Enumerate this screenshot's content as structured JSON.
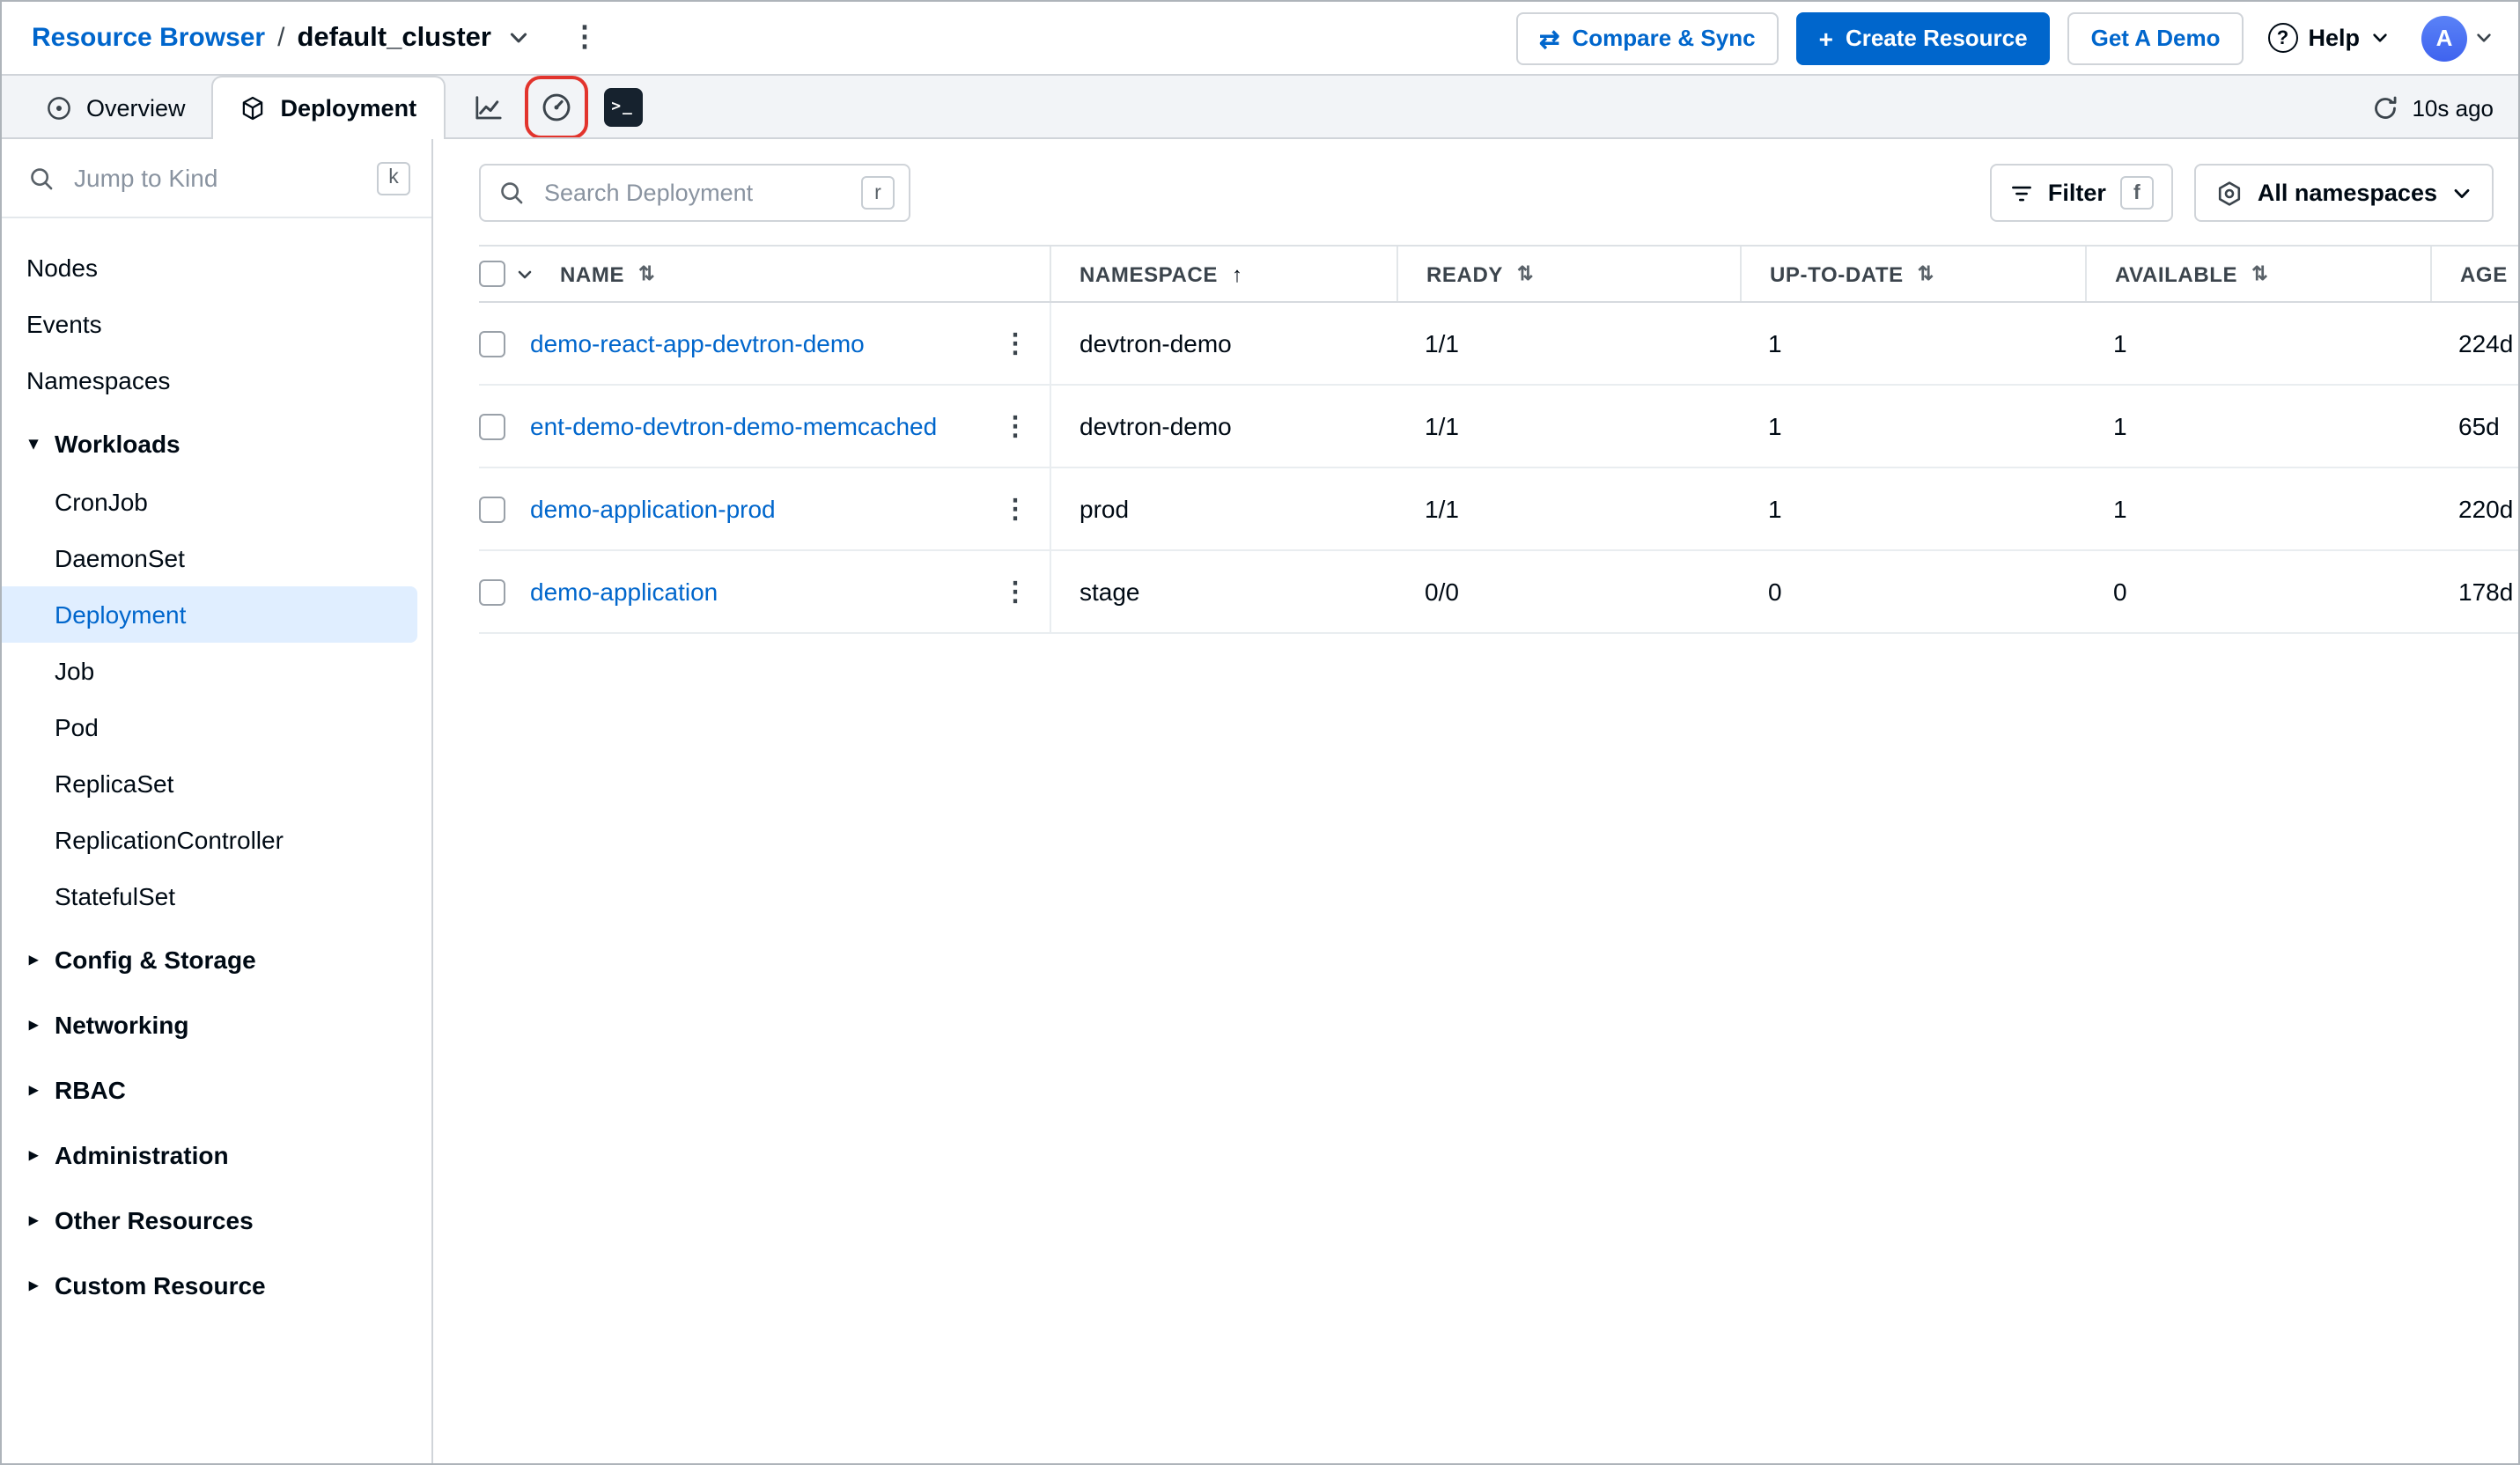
{
  "colors": {
    "accent_blue": "#0066CC",
    "primary_button_bg": "#0066CC",
    "selected_item_bg": "#E0EEFF",
    "tabbar_bg": "#F2F4F7",
    "border": "#D0D4D9",
    "text_primary": "#000A14",
    "text_secondary": "#3B444C",
    "annotation_red": "#E2342D"
  },
  "icons": {
    "kebab": "⋮",
    "sort": "⇅",
    "sort_asc": "↑",
    "caret_expanded": "▾",
    "caret_collapsed": "▸",
    "compare_arrows": "⇄",
    "plus": "+",
    "question_mark": "?",
    "terminal_prompt": ">_"
  },
  "topbar": {
    "breadcrumb_root": "Resource Browser",
    "breadcrumb_separator": "/",
    "cluster_name": "default_cluster",
    "compare_sync_label": "Compare & Sync",
    "create_resource_label": "Create Resource",
    "get_demo_label": "Get A Demo",
    "help_label": "Help",
    "avatar_letter": "A"
  },
  "tabbar": {
    "overview_tab": "Overview",
    "deployment_tab": "Deployment",
    "refresh_label": "10s ago"
  },
  "sidebar": {
    "search_placeholder": "Jump to Kind",
    "search_shortcut": "k",
    "items": [
      {
        "label": "Nodes"
      },
      {
        "label": "Events"
      },
      {
        "label": "Namespaces"
      },
      {
        "label": "Workloads"
      },
      {
        "label": "CronJob"
      },
      {
        "label": "DaemonSet"
      },
      {
        "label": "Deployment"
      },
      {
        "label": "Job"
      },
      {
        "label": "Pod"
      },
      {
        "label": "ReplicaSet"
      },
      {
        "label": "ReplicationController"
      },
      {
        "label": "StatefulSet"
      },
      {
        "label": "Config & Storage"
      },
      {
        "label": "Networking"
      },
      {
        "label": "RBAC"
      },
      {
        "label": "Administration"
      },
      {
        "label": "Other Resources"
      },
      {
        "label": "Custom Resource"
      }
    ]
  },
  "toolbar": {
    "search_placeholder": "Search Deployment",
    "search_shortcut": "r",
    "filter_label": "Filter",
    "filter_shortcut": "f",
    "namespace_filter_label": "All namespaces"
  },
  "table": {
    "columns": [
      "NAME",
      "NAMESPACE",
      "READY",
      "UP-TO-DATE",
      "AVAILABLE",
      "AGE"
    ],
    "rows": [
      {
        "name": "demo-react-app-devtron-demo",
        "namespace": "devtron-demo",
        "ready": "1/1",
        "up_to_date": "1",
        "available": "1",
        "age": "224d"
      },
      {
        "name": "ent-demo-devtron-demo-memcached",
        "namespace": "devtron-demo",
        "ready": "1/1",
        "up_to_date": "1",
        "available": "1",
        "age": "65d"
      },
      {
        "name": "demo-application-prod",
        "namespace": "prod",
        "ready": "1/1",
        "up_to_date": "1",
        "available": "1",
        "age": "220d"
      },
      {
        "name": "demo-application",
        "namespace": "stage",
        "ready": "0/0",
        "up_to_date": "0",
        "available": "0",
        "age": "178d"
      }
    ]
  }
}
